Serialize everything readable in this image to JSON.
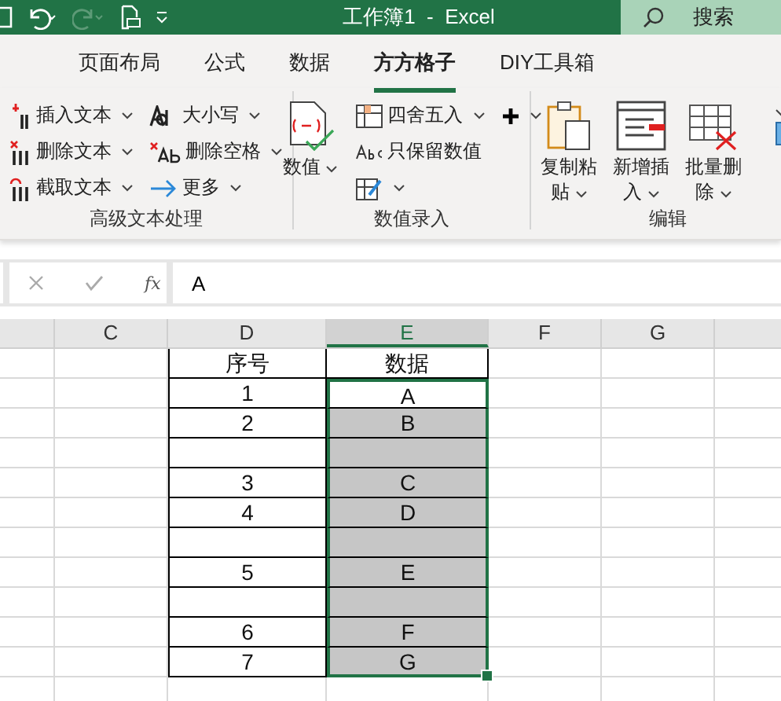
{
  "title_bar": {
    "title": "工作簿1  -  Excel",
    "search_placeholder": "搜索"
  },
  "tabs": [
    {
      "label": "页面布局",
      "selected": false
    },
    {
      "label": "公式",
      "selected": false
    },
    {
      "label": "数据",
      "selected": false
    },
    {
      "label": "方方格子",
      "selected": true
    },
    {
      "label": "DIY工具箱",
      "selected": false
    }
  ],
  "ribbon": [
    {
      "label": "高级文本处理",
      "items": [
        {
          "kind": "small",
          "label": "插入文本",
          "dropdown": true
        },
        {
          "kind": "small",
          "label": "删除文本",
          "dropdown": true
        },
        {
          "kind": "small",
          "label": "截取文本",
          "dropdown": true
        },
        {
          "kind": "small",
          "label": "大小写",
          "dropdown": true
        },
        {
          "kind": "small",
          "label": "删除空格",
          "dropdown": true
        },
        {
          "kind": "small",
          "label": "更多",
          "dropdown": true
        }
      ]
    },
    {
      "label": "数值录入",
      "items": [
        {
          "kind": "large",
          "label": "数值",
          "dropdown": true
        },
        {
          "kind": "small",
          "label": "四舍五入",
          "dropdown": true
        },
        {
          "kind": "small",
          "label": "只保留数值",
          "dropdown": false
        },
        {
          "kind": "small",
          "dropdown": true
        },
        {
          "kind": "small",
          "dropdown": true
        }
      ]
    },
    {
      "label": "编辑",
      "items": [
        {
          "kind": "large",
          "label": "复制粘贴",
          "dropdown": true
        },
        {
          "kind": "large",
          "label": "新增插入",
          "dropdown": true
        },
        {
          "kind": "large",
          "label": "批量删除",
          "dropdown": true
        },
        {
          "kind": "large",
          "dropdown": false
        }
      ]
    }
  ],
  "formula_bar": {
    "function_label": "fx",
    "value": "A"
  },
  "sheet": {
    "columns": [
      {
        "selected": false
      },
      {
        "label": "C",
        "selected": false
      },
      {
        "label": "D",
        "selected": false
      },
      {
        "label": "E",
        "selected": true
      },
      {
        "label": "F",
        "selected": false
      },
      {
        "label": "G",
        "selected": false
      },
      {
        "selected": false
      }
    ],
    "rows": [
      {
        "d": "序号",
        "e": "数据",
        "selected": false
      },
      {
        "d": "1",
        "e": "A",
        "selected": true
      },
      {
        "d": "2",
        "e": "B",
        "selected": true
      },
      {
        "selected": true
      },
      {
        "d": "3",
        "e": "C",
        "selected": true
      },
      {
        "d": "4",
        "e": "D",
        "selected": true
      },
      {
        "selected": true
      },
      {
        "d": "5",
        "e": "E",
        "selected": true
      },
      {
        "selected": true
      },
      {
        "d": "6",
        "e": "F",
        "selected": true
      },
      {
        "d": "7",
        "e": "G",
        "selected": true
      }
    ]
  }
}
